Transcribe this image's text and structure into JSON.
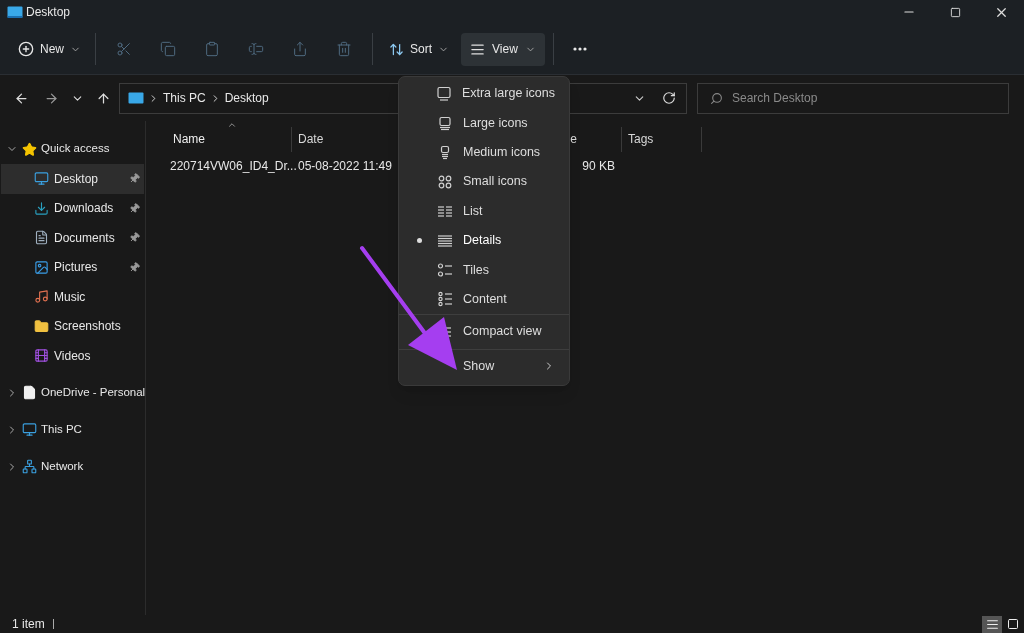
{
  "window": {
    "title": "Desktop"
  },
  "toolbar": {
    "new": {
      "label": "New"
    },
    "actions": [
      {
        "kind": "cut",
        "disabled": true
      },
      {
        "kind": "copy",
        "disabled": true
      },
      {
        "kind": "paste",
        "disabled": true
      },
      {
        "kind": "rename",
        "disabled": true
      },
      {
        "kind": "share",
        "disabled": true
      },
      {
        "kind": "delete",
        "disabled": true
      }
    ],
    "sort": {
      "label": "Sort"
    },
    "view": {
      "label": "View",
      "selected": true
    }
  },
  "address": {
    "path": [
      "This PC",
      "Desktop"
    ]
  },
  "search": {
    "placeholder": "Search Desktop"
  },
  "sidebar": {
    "items": [
      {
        "label": "Quick access",
        "kind": "star",
        "expanded": true,
        "children": [
          {
            "label": "Desktop",
            "kind": "desktop",
            "pinned": true,
            "selected": true
          },
          {
            "label": "Downloads",
            "kind": "download",
            "pinned": true,
            "selected": false
          },
          {
            "label": "Documents",
            "kind": "documents",
            "pinned": true,
            "selected": false
          },
          {
            "label": "Pictures",
            "kind": "pictures",
            "pinned": true,
            "selected": false
          },
          {
            "label": "Music",
            "kind": "music",
            "pinned": false,
            "selected": false
          },
          {
            "label": "Screenshots",
            "kind": "folder",
            "pinned": false,
            "selected": false
          },
          {
            "label": "Videos",
            "kind": "videos",
            "pinned": false,
            "selected": false
          }
        ]
      },
      {
        "label": "OneDrive - Personal",
        "kind": "file",
        "expanded": false
      },
      {
        "label": "This PC",
        "kind": "pc",
        "expanded": false
      },
      {
        "label": "Network",
        "kind": "network",
        "expanded": false
      }
    ]
  },
  "table": {
    "columns": [
      {
        "label": "Name",
        "sorted": true
      },
      {
        "label": "Date",
        "sorted": false
      },
      {
        "label": "e",
        "sorted": false
      },
      {
        "label": "Tags",
        "sorted": false
      }
    ],
    "rows": [
      {
        "name": "220714VW06_ID4_Dr...",
        "date": "05-08-2022 11:49",
        "size": "90 KB"
      }
    ]
  },
  "view_menu": {
    "sections": [
      [
        {
          "label": "Extra large icons",
          "kind": "xl",
          "selected": false
        },
        {
          "label": "Large icons",
          "kind": "large",
          "selected": false
        },
        {
          "label": "Medium icons",
          "kind": "medium",
          "selected": false
        },
        {
          "label": "Small icons",
          "kind": "small",
          "selected": false
        },
        {
          "label": "List",
          "kind": "list",
          "selected": false
        },
        {
          "label": "Details",
          "kind": "details",
          "selected": true
        },
        {
          "label": "Tiles",
          "kind": "tiles",
          "selected": false
        },
        {
          "label": "Content",
          "kind": "content",
          "selected": false
        }
      ],
      [
        {
          "label": "Compact view",
          "kind": "compact"
        }
      ],
      [
        {
          "label": "Show",
          "kind": "submenu"
        }
      ]
    ]
  },
  "status_bar": {
    "text": "1 item",
    "views": [
      {
        "kind": "details",
        "selected": true
      },
      {
        "kind": "large",
        "selected": false
      }
    ]
  }
}
